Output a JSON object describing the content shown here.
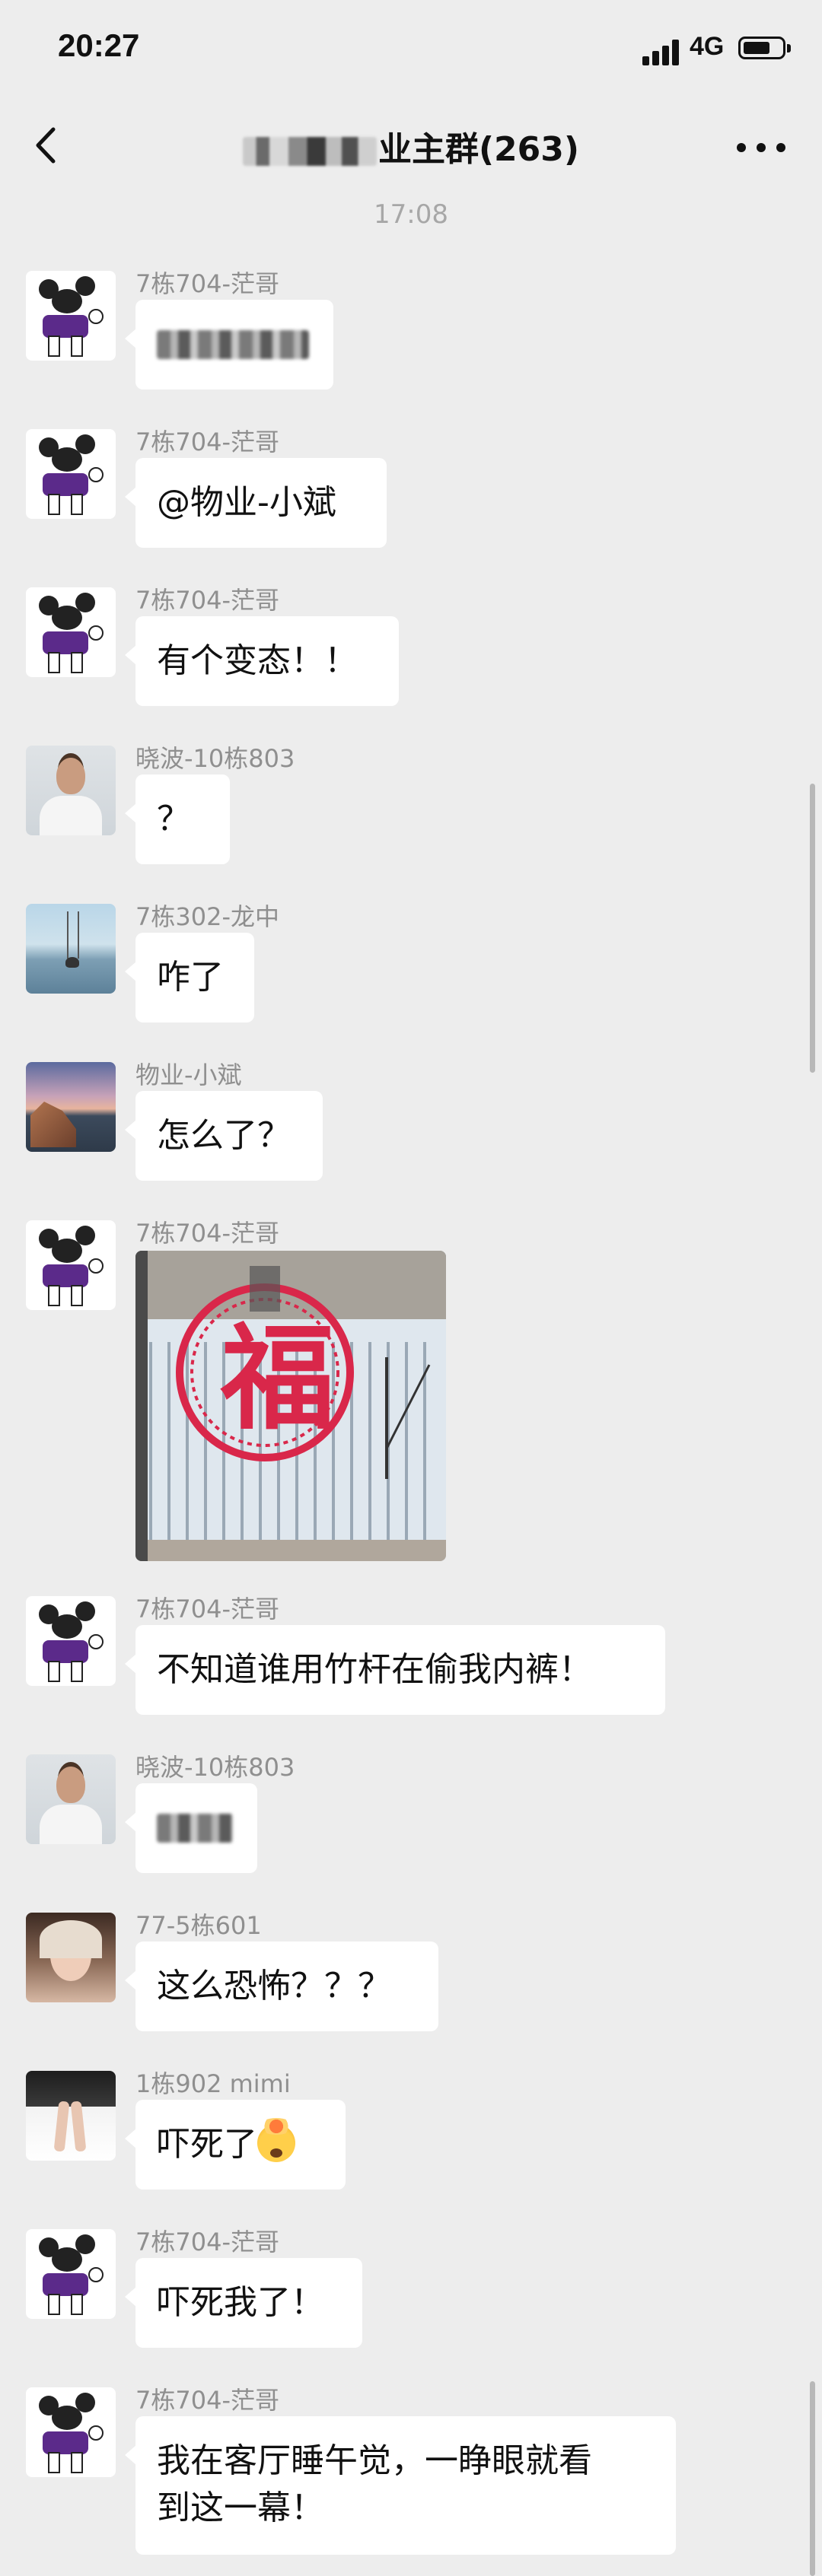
{
  "status_bar": {
    "time": "20:27",
    "network": "4G"
  },
  "header": {
    "title_suffix": "业主群(263)"
  },
  "chat": {
    "timestamp": "17:08",
    "messages": [
      {
        "sender": "7栋704-茫哥",
        "text": ""
      },
      {
        "sender": "7栋704-茫哥",
        "text": "@物业-小斌"
      },
      {
        "sender": "7栋704-茫哥",
        "text": "有个变态！！"
      },
      {
        "sender": "晓波-10栋803",
        "text": "？"
      },
      {
        "sender": "7栋302-龙中",
        "text": "咋了"
      },
      {
        "sender": "物业-小斌",
        "text": "怎么了？"
      },
      {
        "sender": "7栋704-茫哥",
        "text": "",
        "image": "window-fu-character-photo"
      },
      {
        "sender": "7栋704-茫哥",
        "text": "不知道谁用竹杆在偷我内裤！"
      },
      {
        "sender": "晓波-10栋803",
        "text": ""
      },
      {
        "sender": "77-5栋601",
        "text": "这么恐怖？？？"
      },
      {
        "sender": "1栋902 mimi",
        "text": "吓死了",
        "emoji": "exploding-head-emoji"
      },
      {
        "sender": "7栋704-茫哥",
        "text": "吓死我了！"
      },
      {
        "sender": "7栋704-茫哥",
        "text_line1": "我在客厅睡午觉，一睁眼就看",
        "text_line2": "到这一幕！"
      }
    ]
  },
  "icons": {
    "back": "chevron-left-icon",
    "more": "more-horizontal-icon"
  },
  "colors": {
    "background": "#ededed",
    "bubble": "#ffffff",
    "sender": "#8f8f8f",
    "timestamp": "#a7a7a7"
  }
}
